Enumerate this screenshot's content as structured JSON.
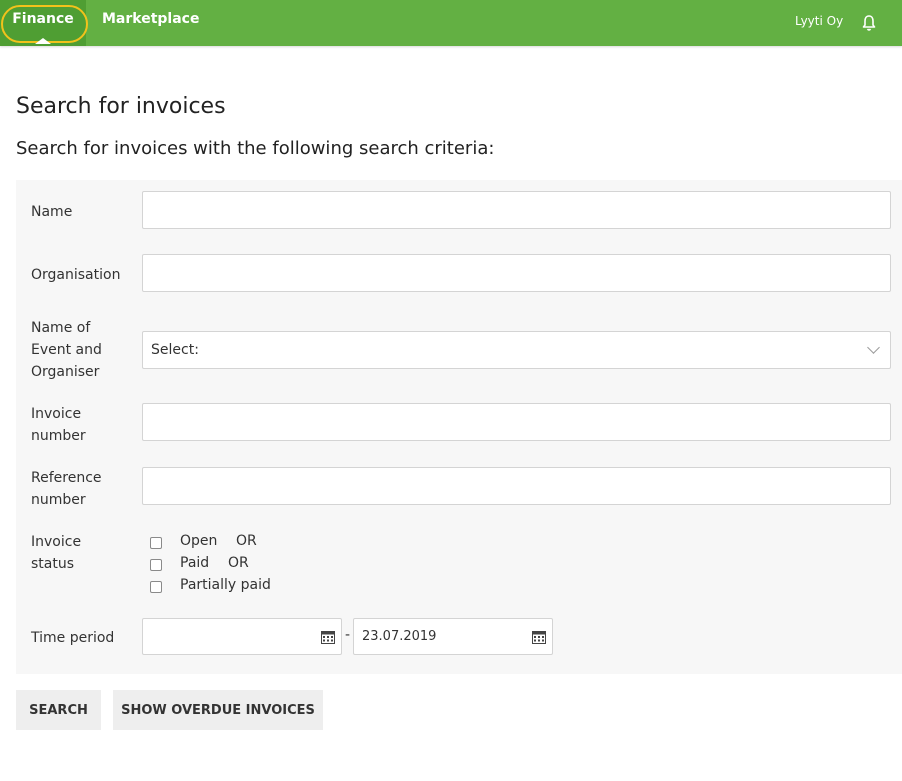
{
  "nav": {
    "tabs": [
      {
        "label": "Finance",
        "active": true
      },
      {
        "label": "Marketplace",
        "active": false
      }
    ],
    "user": "Lyyti Oy",
    "notification_icon": "bell-icon"
  },
  "page": {
    "title": "Search for invoices",
    "subtitle": "Search for invoices with the following search criteria:"
  },
  "form": {
    "name_label": "Name",
    "name_value": "",
    "organisation_label": "Organisation",
    "organisation_value": "",
    "event_label_lines": [
      "Name of",
      "Event and",
      "Organiser"
    ],
    "event_selected": "Select:",
    "invoice_number_label_lines": [
      "Invoice",
      "number"
    ],
    "invoice_number_value": "",
    "reference_number_label_lines": [
      "Reference",
      "number"
    ],
    "reference_number_value": "",
    "invoice_status_label_lines": [
      "Invoice",
      "status"
    ],
    "status_options": [
      {
        "label": "Open",
        "suffix": "OR",
        "checked": false
      },
      {
        "label": "Paid",
        "suffix": "OR",
        "checked": false
      },
      {
        "label": "Partially paid",
        "suffix": "",
        "checked": false
      }
    ],
    "time_period_label": "Time period",
    "date_from": "",
    "date_separator": "-",
    "date_to": "23.07.2019"
  },
  "buttons": {
    "search": "SEARCH",
    "show_overdue": "SHOW OVERDUE INVOICES"
  },
  "colors": {
    "nav_bg": "#63b043",
    "nav_active": "#4f9e33",
    "highlight": "#f2c21b"
  }
}
